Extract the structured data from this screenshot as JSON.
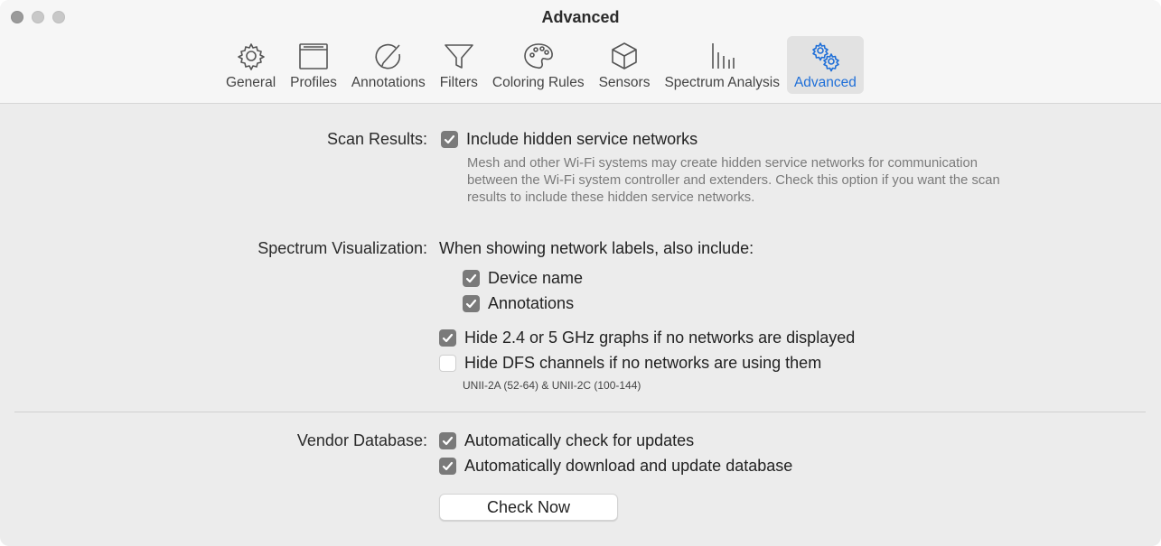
{
  "window": {
    "title": "Advanced"
  },
  "toolbar": {
    "items": [
      {
        "label": "General",
        "icon": "gear-icon"
      },
      {
        "label": "Profiles",
        "icon": "window-icon"
      },
      {
        "label": "Annotations",
        "icon": "pencil-circle-icon"
      },
      {
        "label": "Filters",
        "icon": "funnel-icon"
      },
      {
        "label": "Coloring Rules",
        "icon": "palette-icon"
      },
      {
        "label": "Sensors",
        "icon": "cube-icon"
      },
      {
        "label": "Spectrum Analysis",
        "icon": "spectrum-bars-icon"
      },
      {
        "label": "Advanced",
        "icon": "gears-icon"
      }
    ],
    "selected": "Advanced",
    "accent_color": "#1f6fd8"
  },
  "scan_results": {
    "label": "Scan Results:",
    "option": {
      "label": "Include hidden service networks",
      "checked": true
    },
    "description_lines": [
      "Mesh and other Wi-Fi systems may create hidden service networks for communication",
      "between the Wi-Fi system controller and extenders. Check this option if you want the scan",
      "results to include these hidden service networks."
    ]
  },
  "spectrum_visualization": {
    "label": "Spectrum Visualization:",
    "intro": "When showing network labels, also include:",
    "device_name": {
      "label": "Device name",
      "checked": true
    },
    "annotations": {
      "label": "Annotations",
      "checked": true
    },
    "hide_graphs": {
      "label": "Hide 2.4 or 5 GHz graphs if no networks are displayed",
      "checked": true
    },
    "hide_dfs": {
      "label": "Hide DFS channels if no networks are using them",
      "checked": false
    },
    "dfs_note": "UNII-2A (52-64) & UNII-2C (100-144)"
  },
  "vendor_database": {
    "label": "Vendor Database:",
    "auto_check": {
      "label": "Automatically check for updates",
      "checked": true
    },
    "auto_download": {
      "label": "Automatically download and update database",
      "checked": true
    },
    "check_now_label": "Check Now"
  }
}
